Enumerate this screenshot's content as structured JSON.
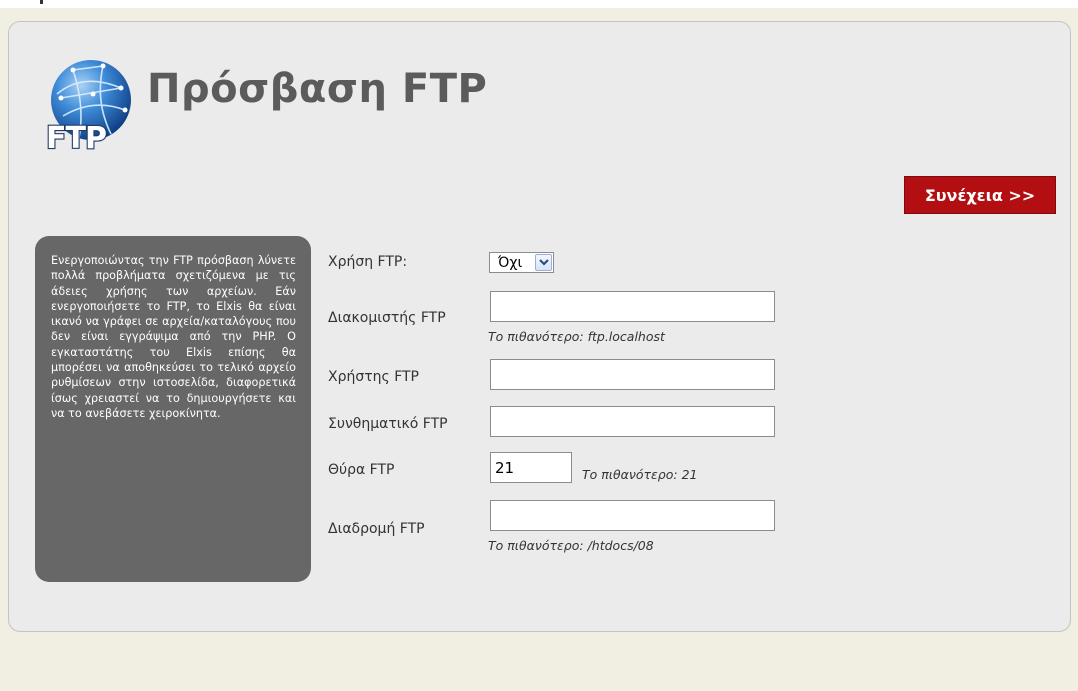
{
  "page": {
    "title": "Πρόσβαση FTP",
    "logo_text": "FTP",
    "continue_label": "Συνέχεια >>"
  },
  "info": {
    "text": "Ενεργοποιώντας την FTP πρόσβαση λύνετε πολλά προβλήματα σχετιζόμενα με τις άδειες χρήσης των αρχείων. Εάν ενεργοποιήσετε το FTP, το Elxis θα είναι ικανό να γράφει σε αρχεία/καταλόγους που δεν είναι εγγράψιμα από την PHP. Ο εγκαταστάτης του Elxis επίσης θα μπορέσει να αποθηκεύσει το τελικό αρχείο ρυθμίσεων στην ιστοσελίδα, διαφορετικά ίσως χρειαστεί να το δημιουργήσετε και να το ανεβάσετε χειροκίνητα."
  },
  "form": {
    "use_ftp": {
      "label": "Χρήση FTP:",
      "value": "Όχι"
    },
    "host": {
      "label": "Διακομιστής FTP",
      "value": "",
      "hint": "Το πιθανότερο: ftp.localhost"
    },
    "user": {
      "label": "Χρήστης FTP",
      "value": ""
    },
    "password": {
      "label": "Συνθηματικό FTP",
      "value": ""
    },
    "port": {
      "label": "Θύρα FTP",
      "value": "21",
      "hint": "Το πιθανότερο: 21"
    },
    "path": {
      "label": "Διαδρομή FTP",
      "value": "",
      "hint": "Το πιθανότερο: /htdocs/08"
    }
  },
  "colors": {
    "accent": "#b30e12",
    "background": "#f1efe2",
    "panel": "#ecebeb",
    "info_box": "#676767"
  },
  "icons": {
    "logo": "ftp-globe-icon",
    "select_arrow": "chevron-down-icon"
  }
}
